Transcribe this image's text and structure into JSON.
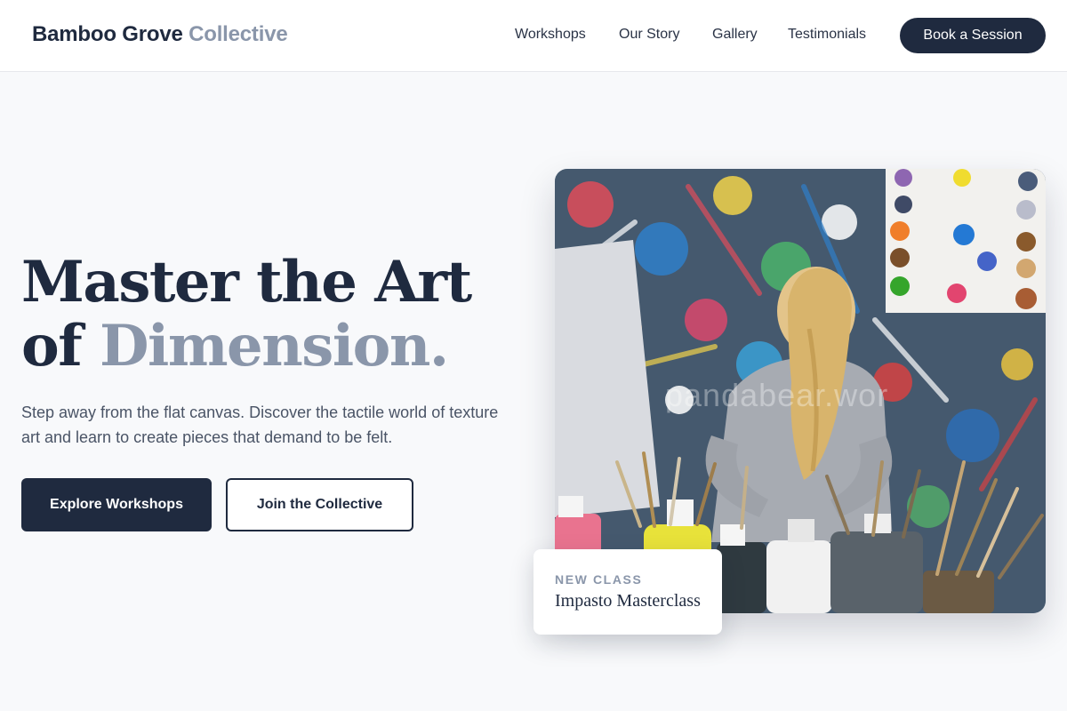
{
  "header": {
    "brand_primary": "Bamboo Grove",
    "brand_accent": "Collective",
    "nav": [
      "Workshops",
      "Our Story",
      "Gallery",
      "Testimonials"
    ],
    "cta_label": "Book a Session"
  },
  "hero": {
    "title_line1": "Master the Art",
    "title_line2_prefix": "of ",
    "title_line2_accent": "Dimension.",
    "subtitle": "Step away from the flat canvas. Discover the tactile world of texture art and learn to create pieces that demand to be felt.",
    "primary_cta": "Explore Workshops",
    "secondary_cta": "Join the Collective"
  },
  "image": {
    "watermark": "pandabear.wor"
  },
  "class_card": {
    "label": "NEW CLASS",
    "title": "Impasto Masterclass"
  },
  "colors": {
    "primary": "#1f2a3f",
    "accent": "#8a96aa",
    "background": "#f8f9fb"
  }
}
